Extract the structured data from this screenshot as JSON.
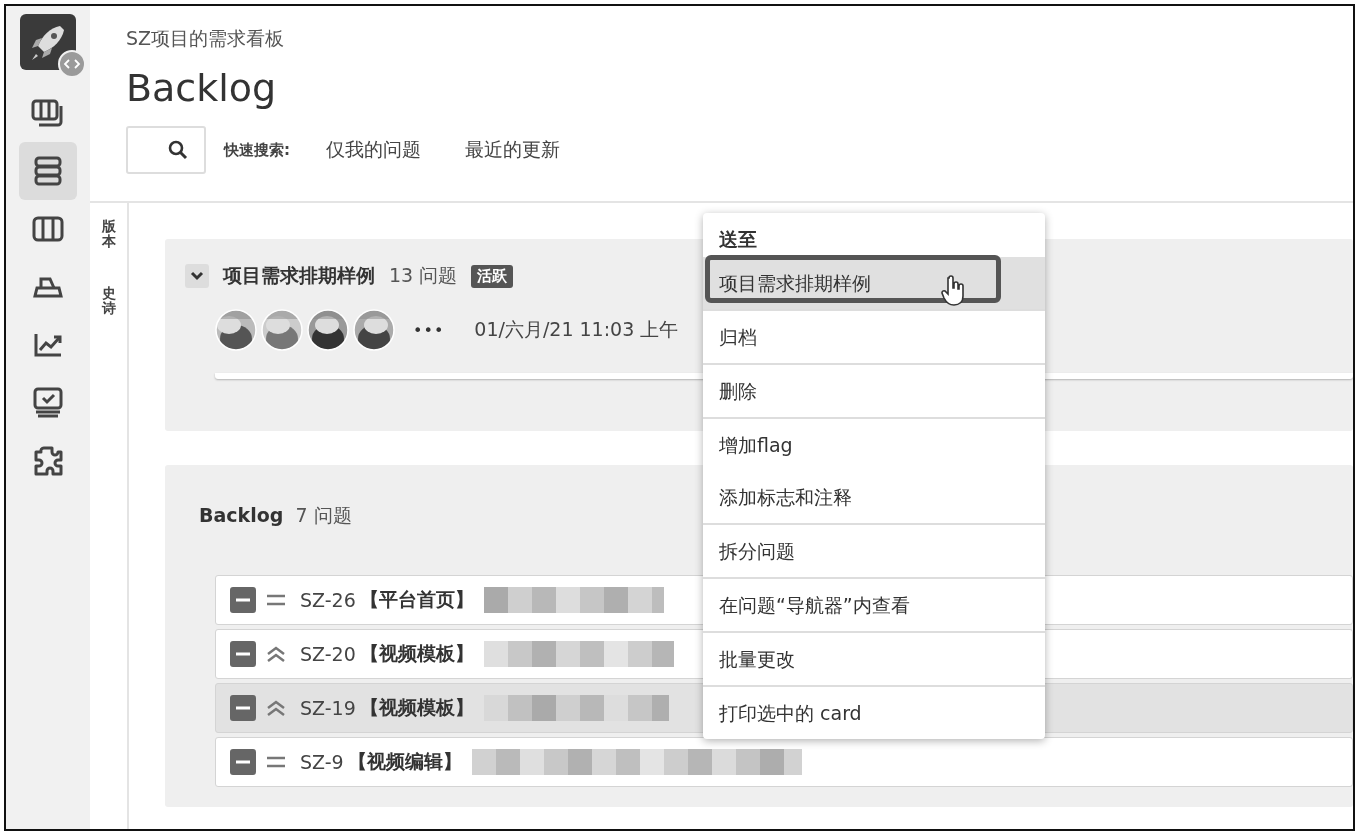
{
  "sidebar": {
    "items": [
      {
        "kind": "board",
        "selected": false
      },
      {
        "kind": "backlog",
        "selected": true
      },
      {
        "kind": "columns",
        "selected": false
      },
      {
        "kind": "releases",
        "selected": false
      },
      {
        "kind": "reports",
        "selected": false
      },
      {
        "kind": "issues",
        "selected": false
      },
      {
        "kind": "addons",
        "selected": false
      }
    ]
  },
  "header": {
    "breadcrumb": "SZ项目的需求看板",
    "title": "Backlog",
    "quick_filters_label": "快速搜索:",
    "quick_filters": [
      "仅我的问题",
      "最近的更新"
    ]
  },
  "side_tabs": [
    "版本",
    "史诗"
  ],
  "sprint": {
    "expanded": true,
    "name": "项目需求排期样例",
    "count": "13 问题",
    "status": "活跃",
    "more": "•••",
    "date": "01/六月/21 11:03 上午"
  },
  "backlog": {
    "title": "Backlog",
    "count": "7 问题",
    "rows": [
      {
        "key": "SZ-26",
        "kind": "medium",
        "category": "【平台首页】",
        "selected": false
      },
      {
        "key": "SZ-20",
        "kind": "high",
        "category": "【视频模板】",
        "selected": false
      },
      {
        "key": "SZ-19",
        "kind": "high",
        "category": "【视频模板】",
        "selected": true
      },
      {
        "key": "SZ-9",
        "kind": "medium",
        "category": "【视频编辑】",
        "selected": false
      }
    ]
  },
  "menu": {
    "heading": "送至",
    "groups": [
      {
        "items": [
          {
            "label": "项目需求排期样例",
            "selected": true
          }
        ]
      },
      {
        "items": [
          {
            "label": "归档",
            "selected": false
          }
        ]
      },
      {
        "items": [
          {
            "label": "删除",
            "selected": false
          }
        ]
      },
      {
        "items": [
          {
            "label": "增加flag",
            "selected": false
          },
          {
            "label": "添加标志和注释",
            "selected": false
          }
        ]
      },
      {
        "items": [
          {
            "label": "拆分问题",
            "selected": false
          }
        ]
      },
      {
        "items": [
          {
            "label": "在问题“导航器”内查看",
            "selected": false
          }
        ]
      },
      {
        "items": [
          {
            "label": "批量更改",
            "selected": false
          }
        ]
      },
      {
        "items": [
          {
            "label": "打印选中的 card",
            "selected": false
          }
        ]
      }
    ]
  }
}
